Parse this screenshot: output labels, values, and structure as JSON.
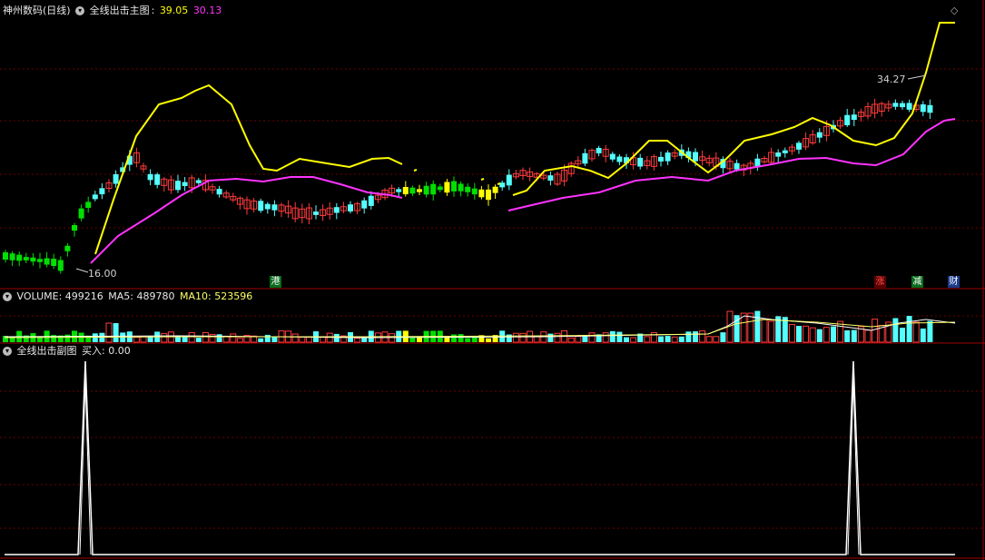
{
  "main_panel": {
    "stock": "神州数码(日线)",
    "indicator": "全线出击主图",
    "separator": ":",
    "value_yellow": "39.05",
    "value_magenta": "30.13",
    "high_label": "34.27",
    "low_label": "16.00",
    "tags": {
      "gang": "港",
      "zhang": "涨",
      "jian": "减",
      "cai": "财"
    }
  },
  "volume_panel": {
    "label": "VOLUME: 499216",
    "ma5": "MA5: 489780",
    "ma10": "MA10: 523596"
  },
  "sub_panel": {
    "title": "全线出击副图",
    "buy": "买入: 0.00"
  },
  "colors": {
    "background": "#000000",
    "up": "#ff3b3b",
    "down": "#54ffff",
    "green": "#00e000",
    "yellow_line": "#ffff00",
    "magenta_line": "#ff33ff",
    "grid": "#8b0000"
  },
  "icons": [
    "chevron-down-icon",
    "diamond-icon"
  ],
  "chart_data": [
    {
      "type": "candlestick",
      "title": "全线出击主图",
      "series": [
        {
          "name": "全线出击主图",
          "values": [
            39.05
          ]
        },
        {
          "name": "",
          "values": [
            30.13
          ]
        }
      ],
      "annotations": [
        "34.27",
        "16.00"
      ]
    },
    {
      "type": "bar",
      "title": "VOLUME",
      "values": [
        499216
      ],
      "ma5": 489780,
      "ma10": 523596
    },
    {
      "type": "line",
      "title": "全线出击副图",
      "series": [
        {
          "name": "买入",
          "values": [
            0.0
          ]
        }
      ]
    }
  ]
}
